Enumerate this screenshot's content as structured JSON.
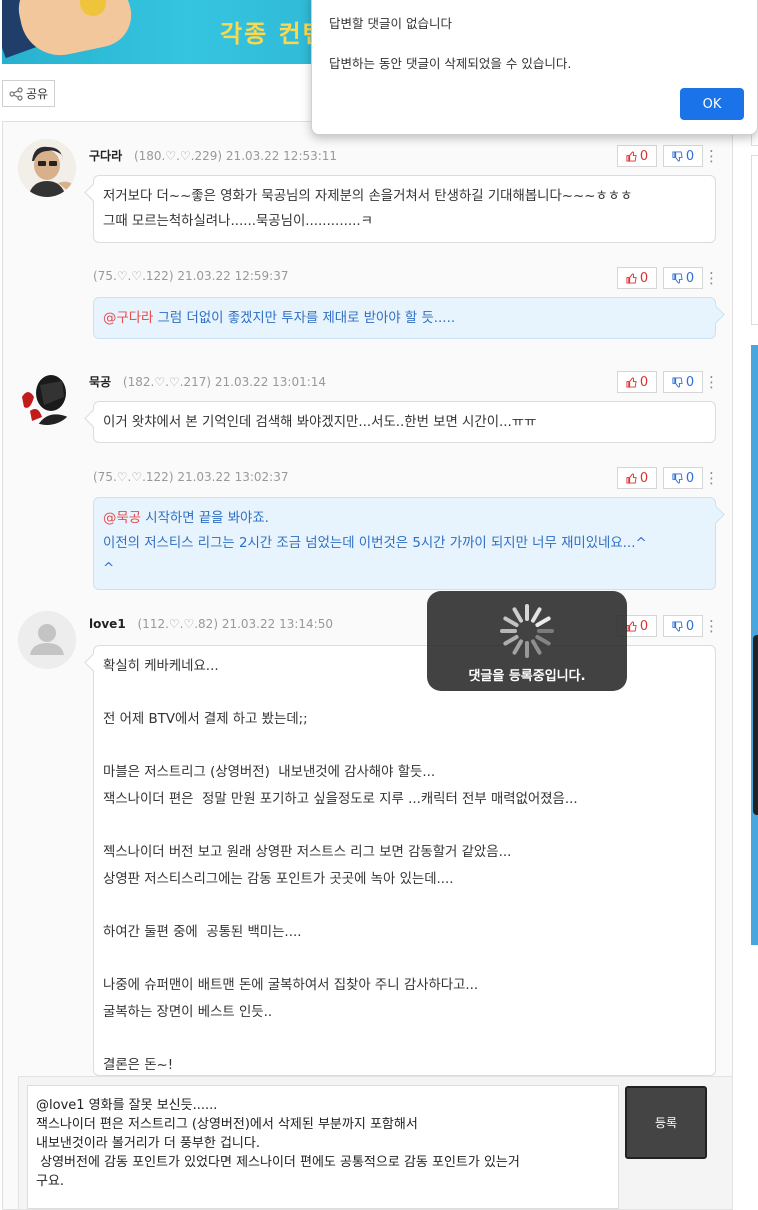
{
  "banner": {
    "text": "각종 컨텐"
  },
  "share": {
    "label": "공유"
  },
  "dialog": {
    "line1": "답변할 댓글이 없습니다",
    "line2": "답변하는 동안 댓글이 삭제되었을 수 있습니다.",
    "ok_label": "OK"
  },
  "comments": [
    {
      "nick": "구다라",
      "ip": "(180.♡.♡.229)",
      "time": "21.03.22 12:53:11",
      "likes": "0",
      "dislikes": "0",
      "lines": [
        "저거보다 더~~좋은 영화가 묵공님의 자제분의 손을거쳐서 탄생하길 기대해봅니다~~~ㅎㅎㅎ",
        "그때 모르는척하실려나......묵공님이.............ㅋ"
      ]
    },
    {
      "ip": "(75.♡.♡.122)",
      "time": "21.03.22 12:59:37",
      "likes": "0",
      "dislikes": "0",
      "mention": "@구다라",
      "text": " 그럼 더없이 좋겠지만 투자를 제대로 받아야 할 듯....."
    },
    {
      "nick": "묵공",
      "ip": "(182.♡.♡.217)",
      "time": "21.03.22 13:01:14",
      "likes": "0",
      "dislikes": "0",
      "lines": [
        "이거 왓챠에서 본 기억인데 검색해 봐야겠지만...서도..한번 보면 시간이...ㅠㅠ"
      ]
    },
    {
      "ip": "(75.♡.♡.122)",
      "time": "21.03.22 13:02:37",
      "likes": "0",
      "dislikes": "0",
      "mention": "@묵공",
      "text": " 시작하면 끝을 봐야죠.",
      "lines": [
        "이전의 저스티스 리그는 2시간 조금 넘었는데 이번것은 5시간 가까이 되지만 너무 재미있네요...^",
        "^"
      ]
    },
    {
      "nick": "love1",
      "ip": "(112.♡.♡.82)",
      "time": "21.03.22 13:14:50",
      "likes": "0",
      "dislikes": "0",
      "lines": [
        "확실히 케바케네요...",
        "",
        "전 어제 BTV에서 결제 하고 봤는데;;",
        "",
        "마블은 저스트리그 (상영버전)  내보낸것에 감사해야 할듯...",
        "잭스나이더 편은  정말 만원 포기하고 싶을정도로 지루 ...캐릭터 전부 매력없어졌음...",
        "",
        "젝스나이더 버전 보고 원래 상영판 저스트스 리그 보면 감동할거 같았음...",
        "상영판 저스티스리그에는 감동 포인트가 곳곳에 녹아 있는데....",
        "",
        "하여간 둘편 중에  공통된 백미는....",
        "",
        "나중에 슈퍼맨이 배트맨 돈에 굴복하여서 집찾아 주니 감사하다고...",
        "굴복하는 장면이 베스트 인듯..",
        "",
        "결론은 돈~!"
      ]
    }
  ],
  "loading": {
    "text": "댓글을 등록중입니다."
  },
  "composer": {
    "value": "@love1 영화를 잘못 보신듯......\n잭스나이더 편은 저스트리그 (상영버전)에서 삭제된 부분까지 포함해서\n내보낸것이라 볼거리가 더 풍부한 겁니다.\n 상영버전에 감동 포인트가 있었다면 제스나이더 편에도 공통적으로 감동 포인트가 있는거\n구요.",
    "submit_label": "등록"
  }
}
